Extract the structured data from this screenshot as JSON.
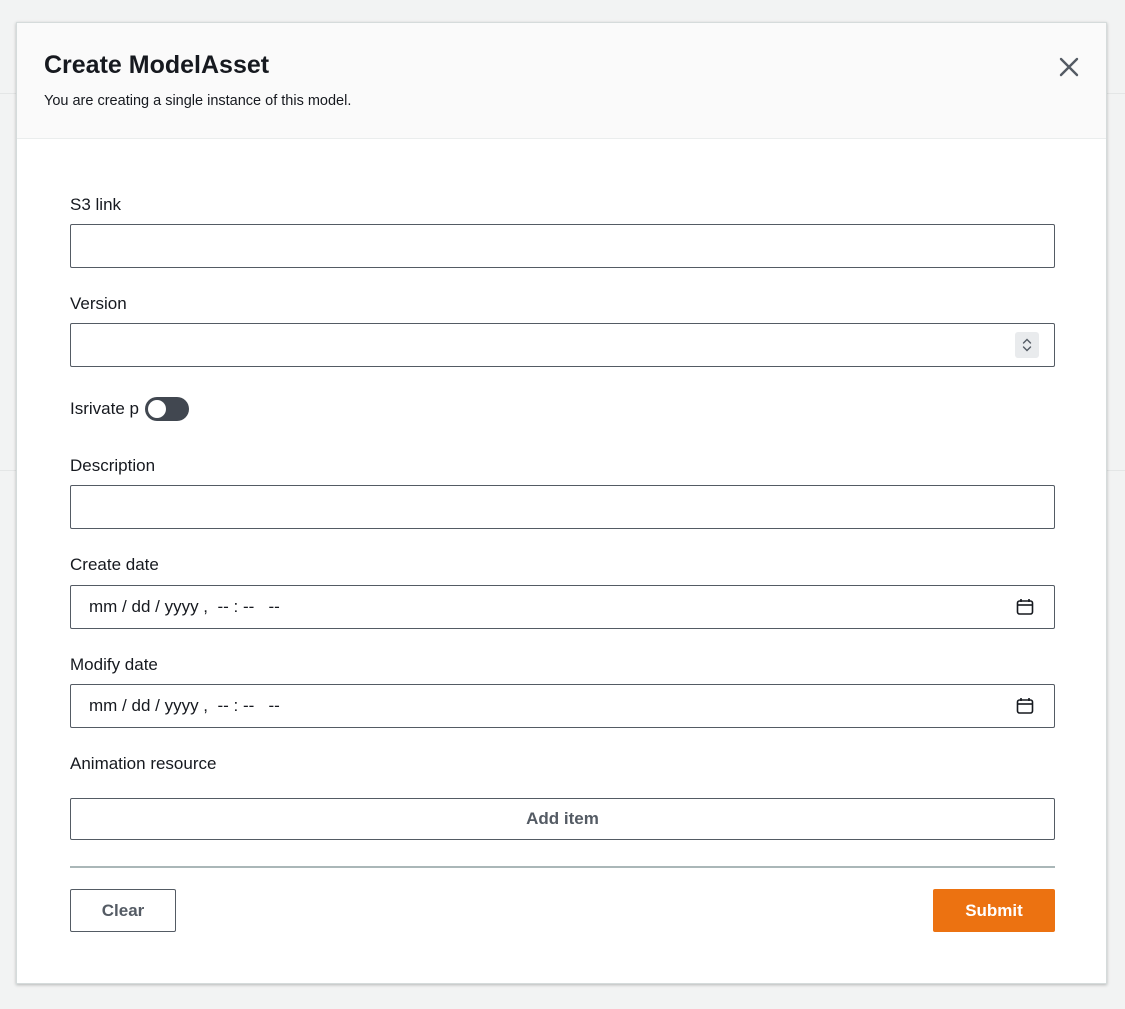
{
  "modal": {
    "title": "Create ModelAsset",
    "subtitle": "You are creating a single instance of this model."
  },
  "form": {
    "s3_link": {
      "label": "S3 link",
      "value": ""
    },
    "version": {
      "label": "Version",
      "value": ""
    },
    "is_private": {
      "label": "Isrivate p",
      "checked": false
    },
    "description": {
      "label": "Description",
      "value": ""
    },
    "create_date": {
      "label": "Create date",
      "placeholder": "mm / dd / yyyy ,  -- : --   --"
    },
    "modify_date": {
      "label": "Modify date",
      "placeholder": "mm / dd / yyyy ,  -- : --   --"
    },
    "animation_resource": {
      "label": "Animation resource",
      "add_label": "Add item"
    }
  },
  "actions": {
    "clear_label": "Clear",
    "submit_label": "Submit"
  },
  "colors": {
    "accent": "#ec7211",
    "border": "#545b64",
    "toggle_off": "#414750",
    "header_bg": "#fafafa"
  },
  "icons": {
    "close": "close-icon",
    "calendar": "calendar-icon",
    "spinner": "chevron-up-down-icon"
  }
}
